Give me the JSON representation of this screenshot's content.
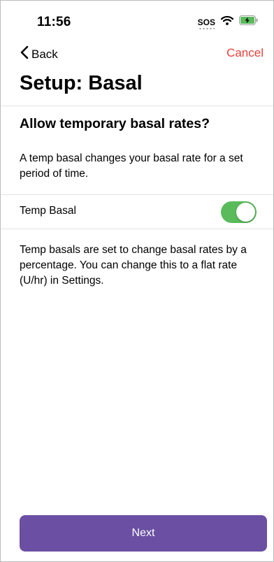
{
  "status_bar": {
    "time": "11:56",
    "sos_label": "SOS",
    "icons": [
      "wifi-icon",
      "battery-charging-icon"
    ],
    "battery_color": "#5abb5b"
  },
  "nav": {
    "back_label": "Back",
    "back_icon": "chevron-left-icon",
    "cancel_label": "Cancel",
    "cancel_color": "#e5403a"
  },
  "page": {
    "title": "Setup: Basal",
    "section_heading": "Allow temporary basal rates?",
    "intro_text": "A temp basal changes your basal rate for a set period of time.",
    "toggle_label": "Temp Basal",
    "toggle_on": true,
    "toggle_color": "#5abb5b",
    "info_text": "Temp basals are set to change basal rates by a percentage. You can change this to a flat rate (U/hr) in Settings."
  },
  "footer": {
    "next_label": "Next",
    "next_color": "#6a4fa2"
  }
}
